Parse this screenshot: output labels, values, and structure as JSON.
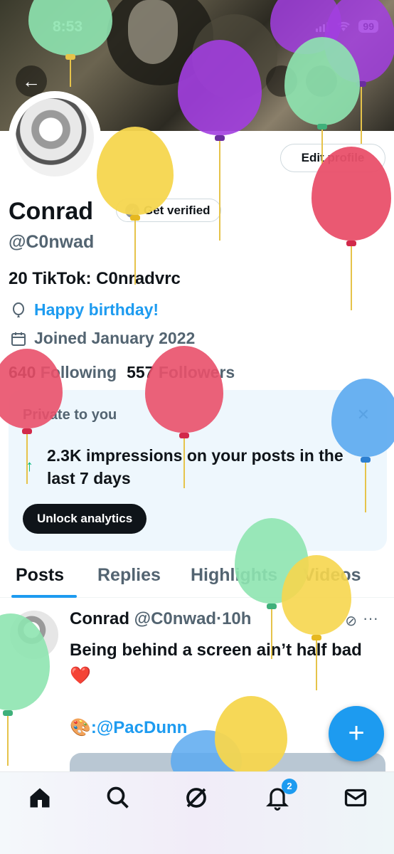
{
  "status_bar": {
    "time": "8:53",
    "battery": "99"
  },
  "profile": {
    "edit_label": "Edit profile",
    "name": "Conrad",
    "verify_label": "Get verified",
    "handle": "@C0nwad",
    "bio": "20 TikTok: C0nradvrc",
    "birthday": "Happy birthday!",
    "joined": "Joined January 2022",
    "following_count": "640",
    "following_label": "Following",
    "followers_count": "557",
    "followers_label": "Followers"
  },
  "analytics_card": {
    "title": "Private to you",
    "impressions": "2.3K impressions on your posts in the last 7 days",
    "button": "Unlock analytics"
  },
  "tabs": [
    {
      "label": "Posts",
      "active": true
    },
    {
      "label": "Replies"
    },
    {
      "label": "Highlights"
    },
    {
      "label": "Videos"
    }
  ],
  "post": {
    "author": "Conrad",
    "handle": "@C0nwad",
    "time": "·10h",
    "text": "Being behind a screen ain’t half bad ❤️",
    "credit": "🎨:@PacDunn"
  },
  "nav": {
    "notifications_badge": "2"
  },
  "colors": {
    "accent": "#1d9bf0",
    "balloon_green": "#8ee4b0",
    "balloon_purple": "#a23ee0",
    "balloon_yellow": "#f6d64e",
    "balloon_red": "#e9506a",
    "balloon_blue": "#5aa9f0"
  }
}
